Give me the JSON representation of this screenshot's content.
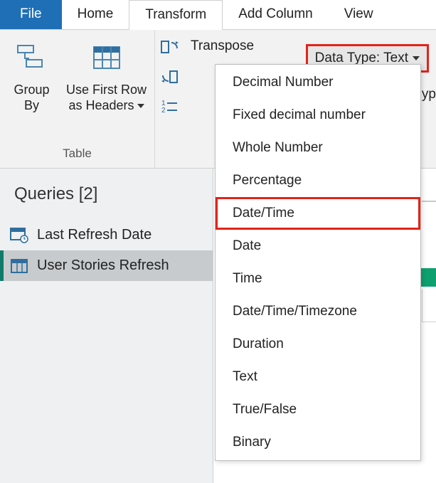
{
  "tabs": {
    "file": "File",
    "home": "Home",
    "transform": "Transform",
    "add_column": "Add Column",
    "view": "View"
  },
  "ribbon": {
    "group_by": {
      "line1": "Group",
      "line2": "By"
    },
    "use_first_row": {
      "line1": "Use First Row",
      "line2": "as Headers"
    },
    "table_group_label": "Table",
    "transpose_label": "Transpose",
    "data_type_button": "Data Type: Text",
    "typ_fragment": "yp"
  },
  "data_type_menu": [
    "Decimal Number",
    "Fixed decimal number",
    "Whole Number",
    "Percentage",
    "Date/Time",
    "Date",
    "Time",
    "Date/Time/Timezone",
    "Duration",
    "Text",
    "True/False",
    "Binary"
  ],
  "data_type_highlight_index": 4,
  "queries": {
    "header": "Queries [2]",
    "items": [
      {
        "label": "Last Refresh Date",
        "selected": false,
        "icon": "clock-table"
      },
      {
        "label": "User Stories Refresh",
        "selected": true,
        "icon": "table"
      }
    ]
  }
}
